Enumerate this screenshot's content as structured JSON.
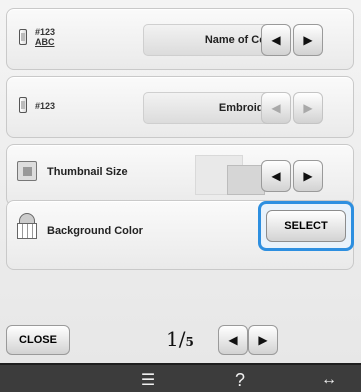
{
  "rows": {
    "row1": {
      "code_top": "#123",
      "code_bottom": "ABC",
      "value": "Name of Color"
    },
    "row2": {
      "code": "#123",
      "value": "Embroidery"
    },
    "row3": {
      "label": "Thumbnail Size"
    },
    "row4": {
      "label": "Background Color",
      "button": "SELECT"
    }
  },
  "footer": {
    "close": "CLOSE",
    "page_num": "1",
    "page_total": "5"
  },
  "icons": {
    "left": "◀",
    "right": "▶",
    "toolbar1": "☰",
    "toolbar2": "?",
    "toolbar3": "↔"
  }
}
